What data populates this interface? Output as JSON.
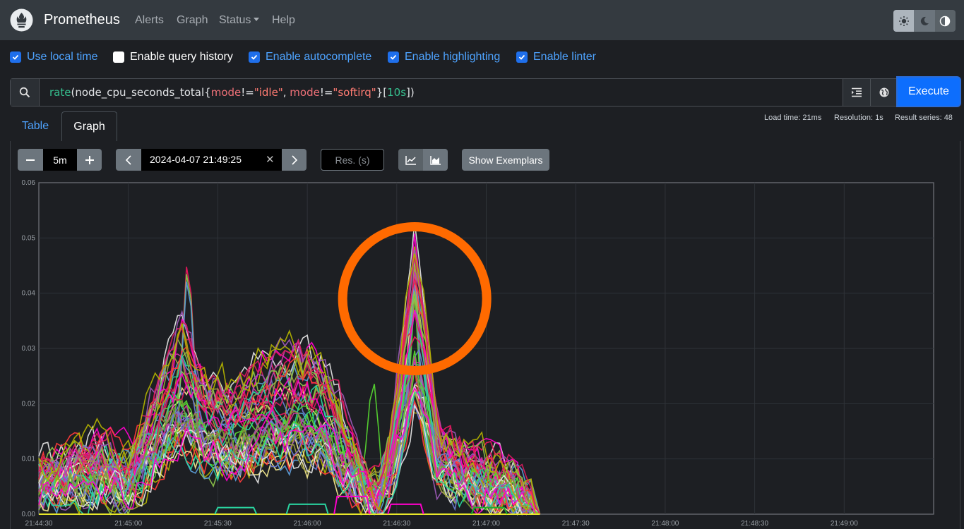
{
  "navbar": {
    "brand": "Prometheus",
    "links": [
      "Alerts",
      "Graph",
      "Status",
      "Help"
    ]
  },
  "options": [
    {
      "label": "Use local time",
      "checked": true
    },
    {
      "label": "Enable query history",
      "checked": false
    },
    {
      "label": "Enable autocomplete",
      "checked": true
    },
    {
      "label": "Enable highlighting",
      "checked": true
    },
    {
      "label": "Enable linter",
      "checked": true
    }
  ],
  "query": {
    "fn": "rate",
    "open": "(",
    "metric": "node_cpu_seconds_total",
    "brace_open": "{",
    "label1": "mode",
    "op1": "!=",
    "val1": "\"idle\"",
    "comma": ", ",
    "label2": "mode",
    "op2": "!=",
    "val2": "\"softirq\"",
    "brace_close": "}",
    "range_open": "[",
    "duration": "10s",
    "range_close": "])",
    "execute_label": "Execute"
  },
  "stats": {
    "load_time": "Load time: 21ms",
    "resolution": "Resolution: 1s",
    "result_series": "Result series: 48"
  },
  "tabs": [
    "Table",
    "Graph"
  ],
  "controls": {
    "range": "5m",
    "end_time": "2024-04-07 21:49:25",
    "resolution_placeholder": "Res. (s)",
    "show_exemplars": "Show Exemplars"
  },
  "chart_data": {
    "type": "line",
    "xlabel": "",
    "ylabel": "",
    "ylim": [
      0,
      0.06
    ],
    "yticks": [
      "0.00",
      "0.01",
      "0.02",
      "0.03",
      "0.04",
      "0.05",
      "0.06"
    ],
    "xticks": [
      "21:44:30",
      "21:45:00",
      "21:45:30",
      "21:46:00",
      "21:46:30",
      "21:47:00",
      "21:47:30",
      "21:48:00",
      "21:48:30",
      "21:49:00"
    ],
    "xlim_seconds": [
      0,
      300
    ],
    "data_end_seconds": 168,
    "series_count": 48,
    "series_profile": [
      {
        "t": 0,
        "y": 0.007
      },
      {
        "t": 10,
        "y": 0.009
      },
      {
        "t": 20,
        "y": 0.01
      },
      {
        "t": 30,
        "y": 0.008
      },
      {
        "t": 36,
        "y": 0.014
      },
      {
        "t": 44,
        "y": 0.024
      },
      {
        "t": 48,
        "y": 0.028
      },
      {
        "t": 56,
        "y": 0.02
      },
      {
        "t": 66,
        "y": 0.018
      },
      {
        "t": 76,
        "y": 0.022
      },
      {
        "t": 86,
        "y": 0.024
      },
      {
        "t": 96,
        "y": 0.021
      },
      {
        "t": 104,
        "y": 0.012
      },
      {
        "t": 110,
        "y": 0.005
      },
      {
        "t": 114,
        "y": 0.004
      },
      {
        "t": 118,
        "y": 0.012
      },
      {
        "t": 122,
        "y": 0.026
      },
      {
        "t": 126,
        "y": 0.04
      },
      {
        "t": 130,
        "y": 0.028
      },
      {
        "t": 134,
        "y": 0.012
      },
      {
        "t": 140,
        "y": 0.01
      },
      {
        "t": 150,
        "y": 0.008
      },
      {
        "t": 158,
        "y": 0.006
      },
      {
        "t": 164,
        "y": 0.003
      },
      {
        "t": 168,
        "y": 0.0
      }
    ],
    "peaks": [
      {
        "t": 50,
        "y": 0.0495
      },
      {
        "t": 112,
        "y": 0.034
      },
      {
        "t": 126,
        "y": 0.0475
      }
    ],
    "annotation": {
      "type": "circle",
      "t": 126,
      "y": 0.039,
      "color": "#ff6a00"
    },
    "colors": [
      "#e8175d",
      "#8bc34a",
      "#5b9bd5",
      "#f0e68c",
      "#9b59b6",
      "#55d430",
      "#a0a040",
      "#ff3b3b",
      "#c83c9e",
      "#6a7bd0",
      "#e0e0e0",
      "#7d9a38",
      "#2ad4a0",
      "#d81b60",
      "#ff00cc",
      "#b0b000"
    ]
  }
}
